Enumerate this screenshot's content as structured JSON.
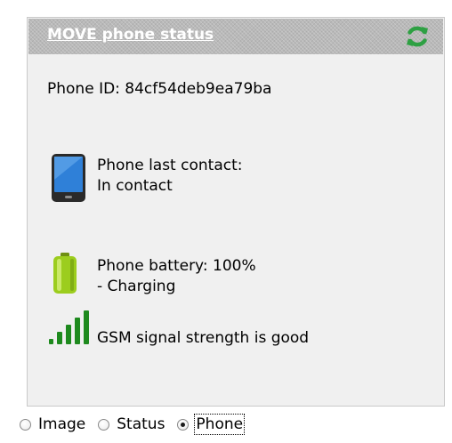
{
  "panel": {
    "title": "MOVE phone status",
    "refresh_icon": "refresh-icon",
    "phone_id": "Phone ID: 84cf54deb9ea79ba",
    "contact": {
      "icon": "smartphone-icon",
      "line1": "Phone last contact:",
      "line2": "In contact"
    },
    "battery": {
      "icon": "battery-icon",
      "level_fraction": 1.0,
      "line1": "Phone battery: 100%",
      "line2": "- Charging"
    },
    "signal": {
      "icon": "signal-strength-icon",
      "bars_filled": 5,
      "bars_total": 5,
      "text": "GSM signal strength is good"
    }
  },
  "view_selector": {
    "options": [
      {
        "label": "Image",
        "checked": false
      },
      {
        "label": "Status",
        "checked": false
      },
      {
        "label": "Phone",
        "checked": true
      }
    ]
  },
  "colors": {
    "header_bg": "#b9b9b9",
    "panel_bg": "#f0f0f0",
    "refresh_green": "#2ea043",
    "battery_green": "#9ccd1e",
    "signal_green": "#1e8a1e",
    "phone_screen_blue": "#2f80d8"
  }
}
